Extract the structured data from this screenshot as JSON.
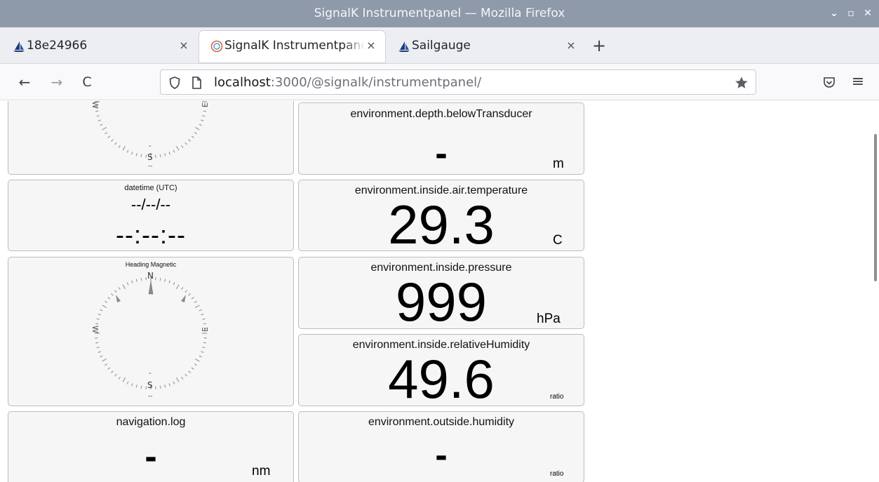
{
  "window": {
    "title": "SignalK Instrumentpanel — Mozilla Firefox",
    "controls": [
      "⌄",
      "▫",
      "✕"
    ]
  },
  "tabs": [
    {
      "label": "18e24966",
      "close": "×",
      "icon": "sailboat-icon"
    },
    {
      "label": "SignalK Instrumentpane",
      "close": "×",
      "icon": "signalk-icon",
      "active": true
    },
    {
      "label": "Sailgauge",
      "close": "×",
      "icon": "sailboat-icon"
    }
  ],
  "new_tab": "+",
  "nav": {
    "back": "←",
    "forward": "→",
    "reload": "C",
    "url_host": "localhost",
    "url_rest": ":3000/@signalk/instrumentpanel/",
    "menu": "≡"
  },
  "widgets": {
    "compass_top": {
      "south": "S",
      "east": "E",
      "west": "W",
      "tick_dash": "-",
      "tick_dashes": "--"
    },
    "datetime": {
      "title": "datetime (UTC)",
      "date": "--/--/--",
      "time": "--:--:--"
    },
    "heading": {
      "title": "Heading Magnetic",
      "north": "N",
      "south": "S",
      "east": "E",
      "west": "W",
      "tick_dash": "-",
      "tick_dashes": "--"
    },
    "navlog": {
      "title": "navigation.log",
      "value": "-",
      "unit": "nm"
    },
    "depth": {
      "title": "environment.depth.belowTransducer",
      "value": "-",
      "unit": "m"
    },
    "air_temp": {
      "title": "environment.inside.air.temperature",
      "value": "29.3",
      "unit": "C"
    },
    "pressure": {
      "title": "environment.inside.pressure",
      "value": "999",
      "unit": "hPa"
    },
    "humidity": {
      "title": "environment.inside.relativeHumidity",
      "value": "49.6",
      "unit": "ratio"
    },
    "outside_humidity": {
      "title": "environment.outside.humidity",
      "value": "-",
      "unit": "ratio"
    }
  }
}
